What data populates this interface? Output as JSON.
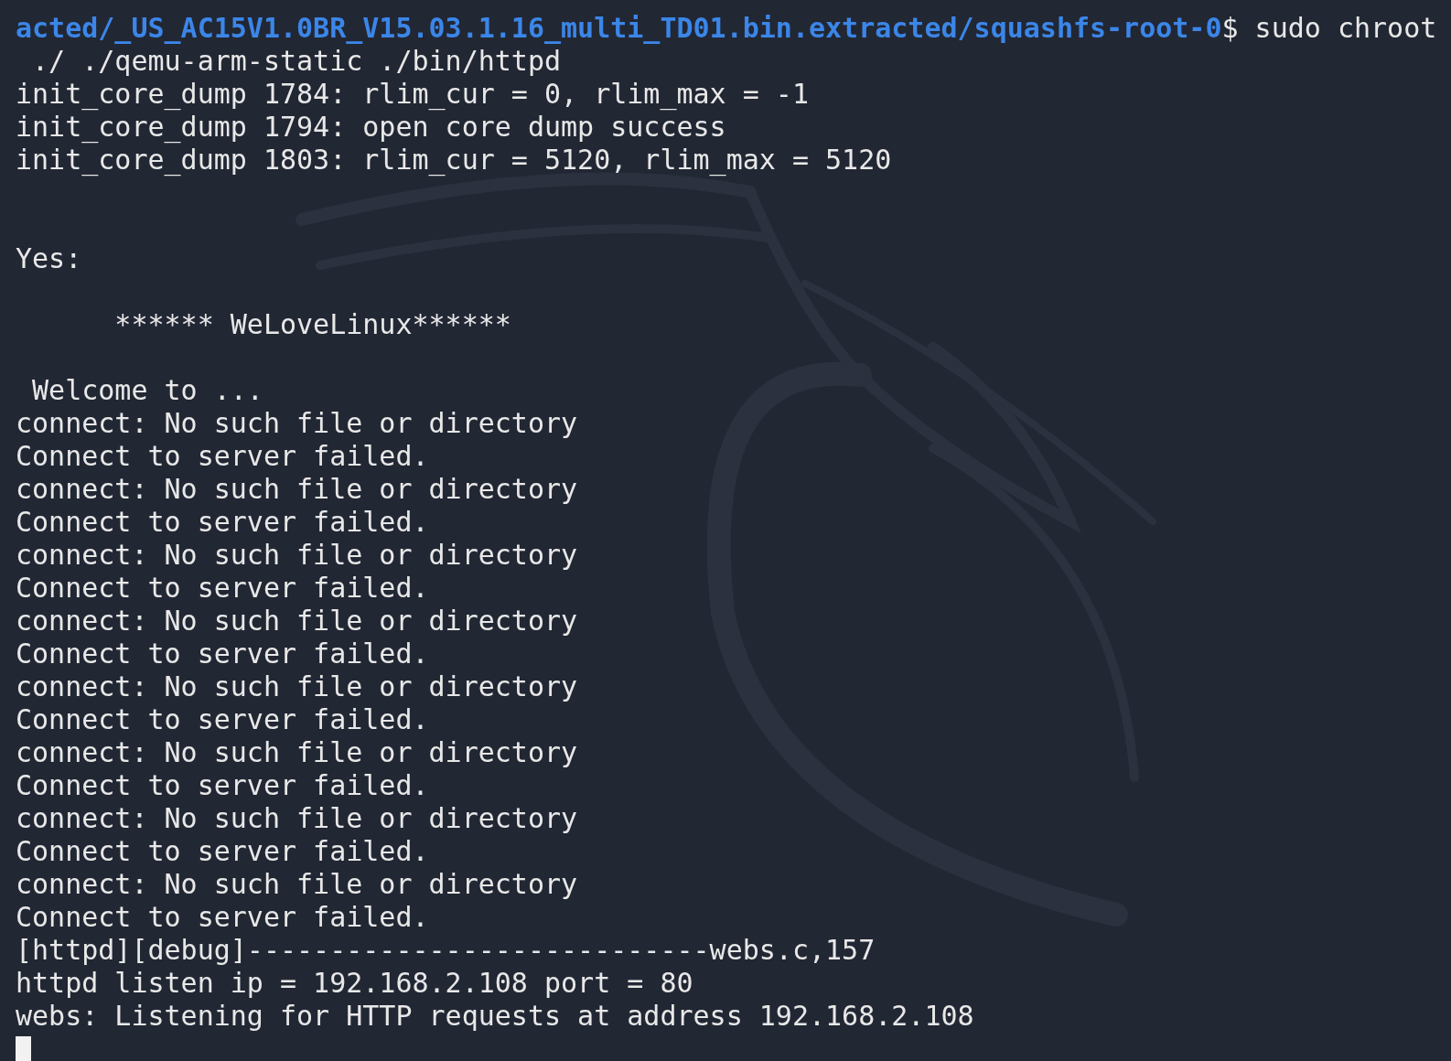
{
  "terminal": {
    "lines": [
      {
        "kind": "prompt",
        "path": "acted/_US_AC15V1.0BR_V15.03.1.16_multi_TD01.bin.extracted/squashfs-root-0",
        "command": "$ sudo chroot"
      },
      {
        "kind": "output",
        "text": " ./ ./qemu-arm-static ./bin/httpd"
      },
      {
        "kind": "output",
        "text": "init_core_dump 1784: rlim_cur = 0, rlim_max = -1"
      },
      {
        "kind": "output",
        "text": "init_core_dump 1794: open core dump success"
      },
      {
        "kind": "output",
        "text": "init_core_dump 1803: rlim_cur = 5120, rlim_max = 5120"
      },
      {
        "kind": "blank"
      },
      {
        "kind": "blank"
      },
      {
        "kind": "output",
        "text": "Yes:"
      },
      {
        "kind": "blank"
      },
      {
        "kind": "output",
        "text": "      ****** WeLoveLinux******"
      },
      {
        "kind": "blank"
      },
      {
        "kind": "output",
        "text": " Welcome to ..."
      },
      {
        "kind": "output",
        "text": "connect: No such file or directory"
      },
      {
        "kind": "output",
        "text": "Connect to server failed."
      },
      {
        "kind": "output",
        "text": "connect: No such file or directory"
      },
      {
        "kind": "output",
        "text": "Connect to server failed."
      },
      {
        "kind": "output",
        "text": "connect: No such file or directory"
      },
      {
        "kind": "output",
        "text": "Connect to server failed."
      },
      {
        "kind": "output",
        "text": "connect: No such file or directory"
      },
      {
        "kind": "output",
        "text": "Connect to server failed."
      },
      {
        "kind": "output",
        "text": "connect: No such file or directory"
      },
      {
        "kind": "output",
        "text": "Connect to server failed."
      },
      {
        "kind": "output",
        "text": "connect: No such file or directory"
      },
      {
        "kind": "output",
        "text": "Connect to server failed."
      },
      {
        "kind": "output",
        "text": "connect: No such file or directory"
      },
      {
        "kind": "output",
        "text": "Connect to server failed."
      },
      {
        "kind": "output",
        "text": "connect: No such file or directory"
      },
      {
        "kind": "output",
        "text": "Connect to server failed."
      },
      {
        "kind": "output",
        "text": "[httpd][debug]----------------------------webs.c,157"
      },
      {
        "kind": "output",
        "text": "httpd listen ip = 192.168.2.108 port = 80"
      },
      {
        "kind": "output",
        "text": "webs: Listening for HTTP requests at address 192.168.2.108"
      },
      {
        "kind": "cursor"
      }
    ]
  }
}
